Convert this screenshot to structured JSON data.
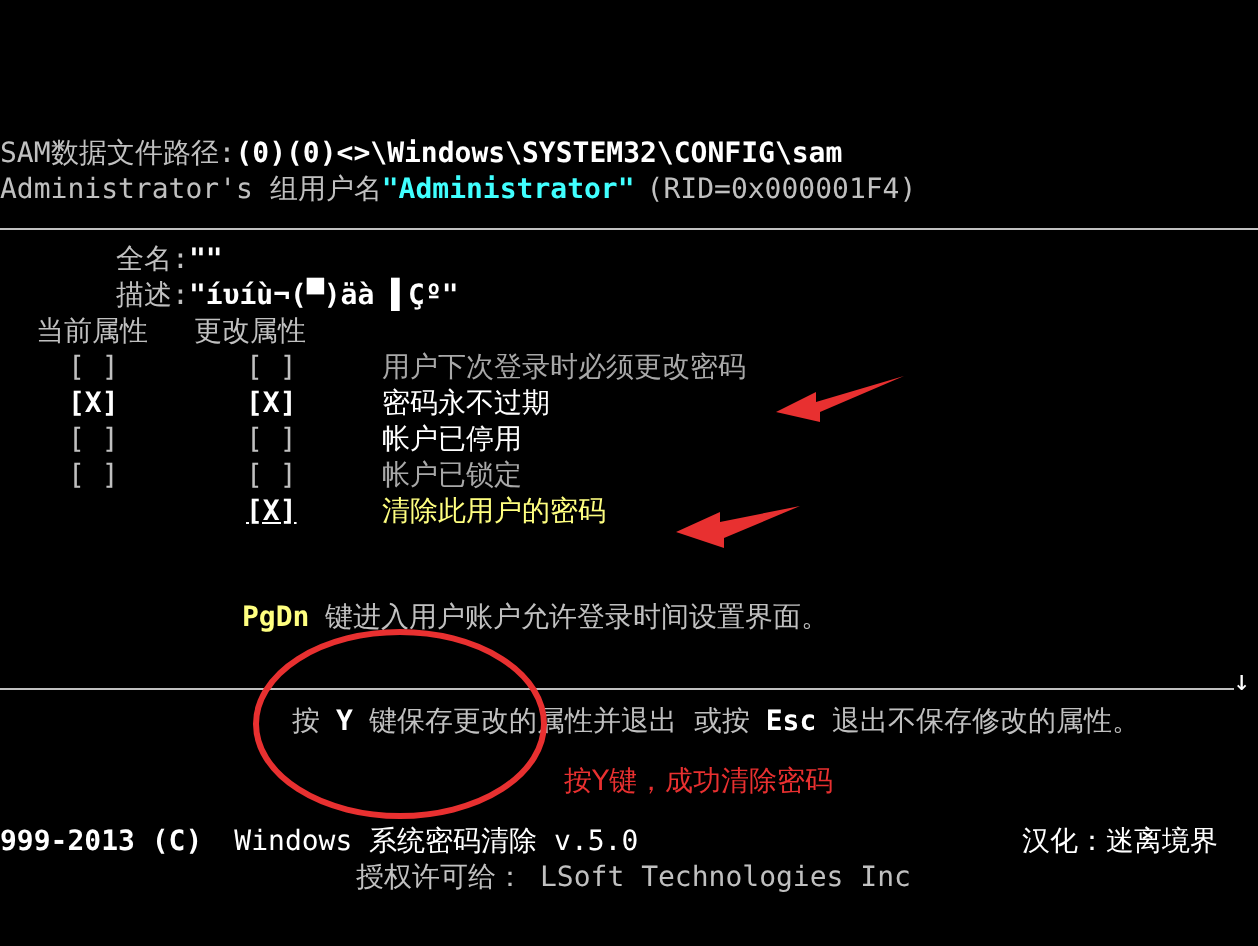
{
  "header": {
    "path_label": "SAM数据文件路径:",
    "path_value": "(0)(0)<>\\Windows\\SYSTEM32\\CONFIG\\sam",
    "account_prefix": "Administrator's 组用户名",
    "account_name": "\"Administrator\"",
    "rid": "(RID=0x000001F4)"
  },
  "fields": [
    {
      "label": "全名:",
      "value": "\"\""
    },
    {
      "label": "描述:",
      "value": "\"íυíù¬(▀)äà ▌Çº\""
    }
  ],
  "columns": [
    "当前属性",
    "更改属性"
  ],
  "attributes": [
    {
      "kind": "dim",
      "current_box": "[ ]",
      "current_checked": false,
      "new_box": "[ ]",
      "new_checked": false,
      "label": "用户下次登录时必须更改密码"
    },
    {
      "kind": "normal",
      "current_box": "[X]",
      "current_checked": true,
      "new_box": "[X]",
      "new_checked": true,
      "label": "密码永不过期"
    },
    {
      "kind": "normal",
      "current_box": "[ ]",
      "current_checked": false,
      "new_box": "[ ]",
      "new_checked": false,
      "label": "帐户已停用"
    },
    {
      "kind": "dim",
      "current_box": "[ ]",
      "current_checked": false,
      "new_box": "[ ]",
      "new_checked": false,
      "label": "帐户已锁定"
    },
    {
      "kind": "action",
      "new_box": "[X]",
      "new_checked": true,
      "label": "清除此用户的密码"
    }
  ],
  "pgdn_hint": {
    "key": "PgDn",
    "text": "键进入用户账户允许登录时间设置界面。"
  },
  "scroll_mark": "↓",
  "save_hint": {
    "prefix": "按",
    "save_key": "Y",
    "save_text": "键保存更改的属性并退出 或按",
    "esc_key": "Esc",
    "esc_text": "退出不保存修改的属性。"
  },
  "annotation": "按Y键，成功清除密码",
  "footer": {
    "copyright": "999-2013 (C)",
    "product": "Windows 系统密码清除 v.5.0",
    "translator": "汉化：迷离境界",
    "license_label": "授权许可给：",
    "licensee": "LSoft Technologies Inc"
  }
}
